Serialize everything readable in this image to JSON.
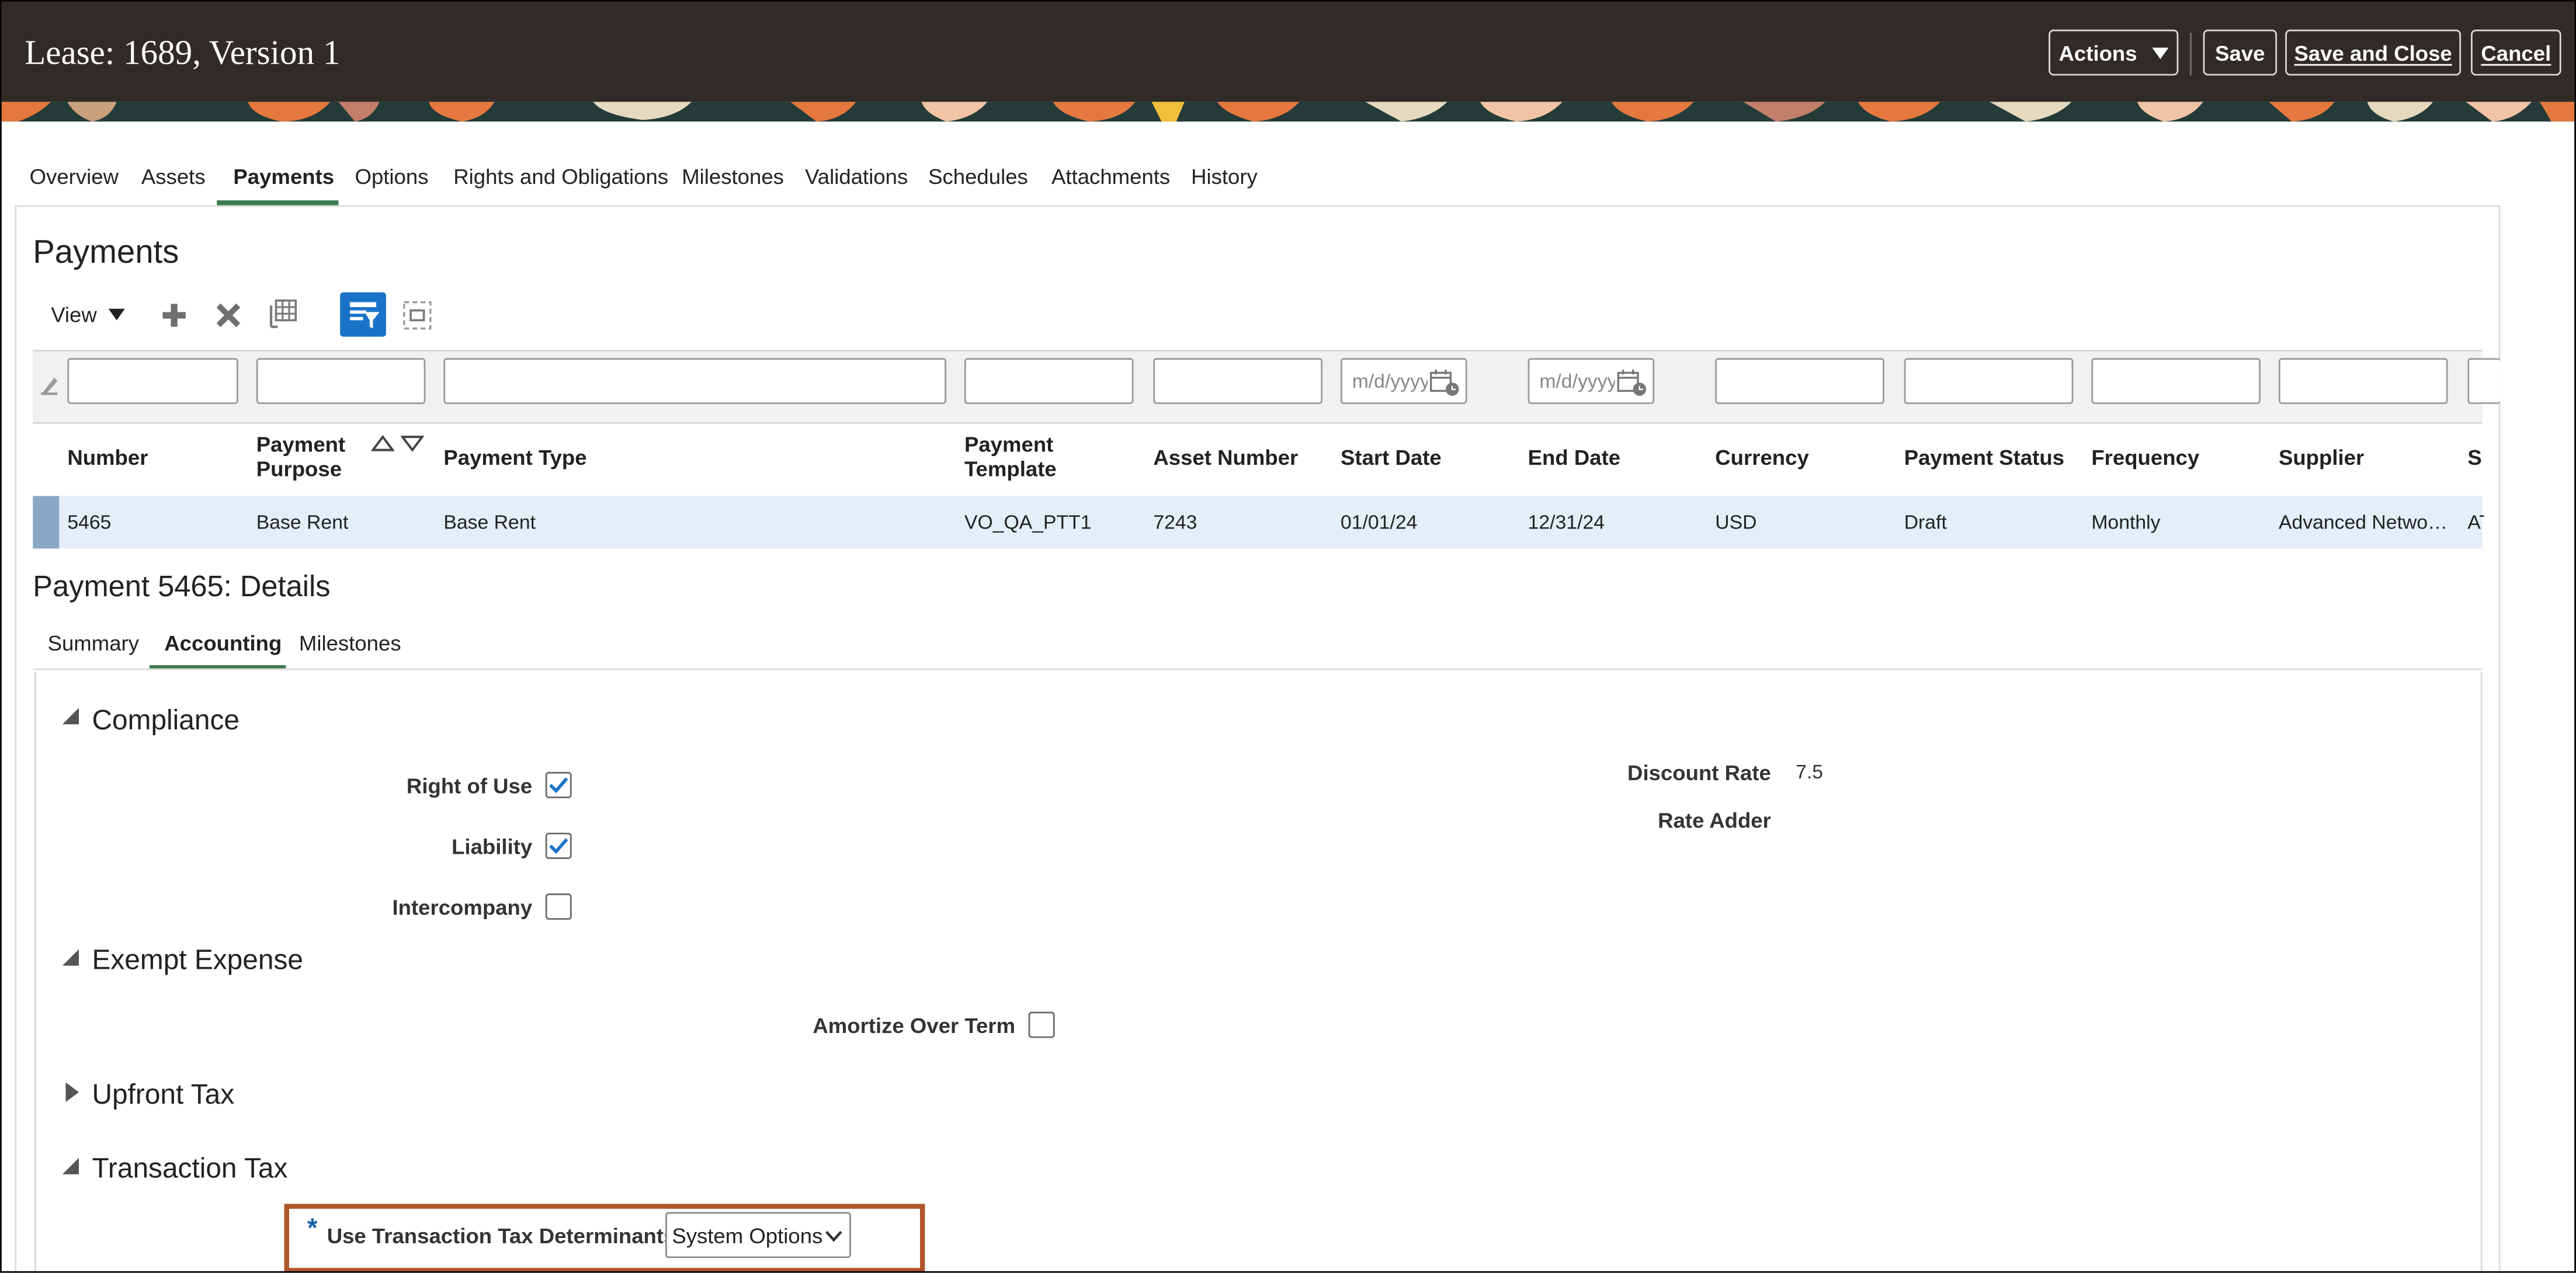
{
  "header": {
    "title": "Lease: 1689, Version 1",
    "actions_label": "Actions",
    "save_label": "Save",
    "save_and_close_label": "Save and Close",
    "cancel_label": "Cancel"
  },
  "tabs": [
    "Overview",
    "Assets",
    "Payments",
    "Options",
    "Rights and Obligations",
    "Milestones",
    "Validations",
    "Schedules",
    "Attachments",
    "History"
  ],
  "active_tab": "Payments",
  "payments": {
    "title": "Payments",
    "view_label": "View",
    "date_placeholder": "m/d/yyyy",
    "columns": [
      {
        "line1": "Number",
        "line2": ""
      },
      {
        "line1": "Payment",
        "line2": "Purpose"
      },
      {
        "line1": "Payment Type",
        "line2": ""
      },
      {
        "line1": "Payment",
        "line2": "Template"
      },
      {
        "line1": "Asset Number",
        "line2": ""
      },
      {
        "line1": "Start Date",
        "line2": ""
      },
      {
        "line1": "End Date",
        "line2": ""
      },
      {
        "line1": "Currency",
        "line2": ""
      },
      {
        "line1": "Payment Status",
        "line2": ""
      },
      {
        "line1": "Frequency",
        "line2": ""
      },
      {
        "line1": "Supplier",
        "line2": ""
      },
      {
        "line1": "S",
        "line2": ""
      }
    ],
    "rows": [
      [
        "5465",
        "Base Rent",
        "Base Rent",
        "VO_QA_PTT1",
        "7243",
        "01/01/24",
        "12/31/24",
        "USD",
        "Draft",
        "Monthly",
        "Advanced Netwo…",
        "AT"
      ]
    ]
  },
  "details": {
    "title": "Payment 5465: Details",
    "tabs": [
      "Summary",
      "Accounting",
      "Milestones"
    ],
    "active_tab": "Accounting",
    "compliance": {
      "title": "Compliance",
      "right_of_use_label": "Right of Use",
      "right_of_use": true,
      "liability_label": "Liability",
      "liability": true,
      "intercompany_label": "Intercompany",
      "intercompany": false,
      "discount_rate_label": "Discount Rate",
      "discount_rate": "7.5",
      "rate_adder_label": "Rate Adder",
      "rate_adder": ""
    },
    "exempt_expense": {
      "title": "Exempt Expense",
      "amortize_label": "Amortize Over Term",
      "amortize": false
    },
    "upfront_tax": {
      "title": "Upfront Tax",
      "expanded": false
    },
    "transaction_tax": {
      "title": "Transaction Tax",
      "required_mark": "*",
      "determinants_label": "Use Transaction Tax Determinants",
      "determinants_value": "System Options"
    }
  },
  "colors": {
    "header_bg": "#302b27",
    "accent_green": "#3c7a4e",
    "selected_row": "#e3eef8",
    "highlight_border": "#b1562c",
    "icon_blue": "#1a73c8"
  }
}
